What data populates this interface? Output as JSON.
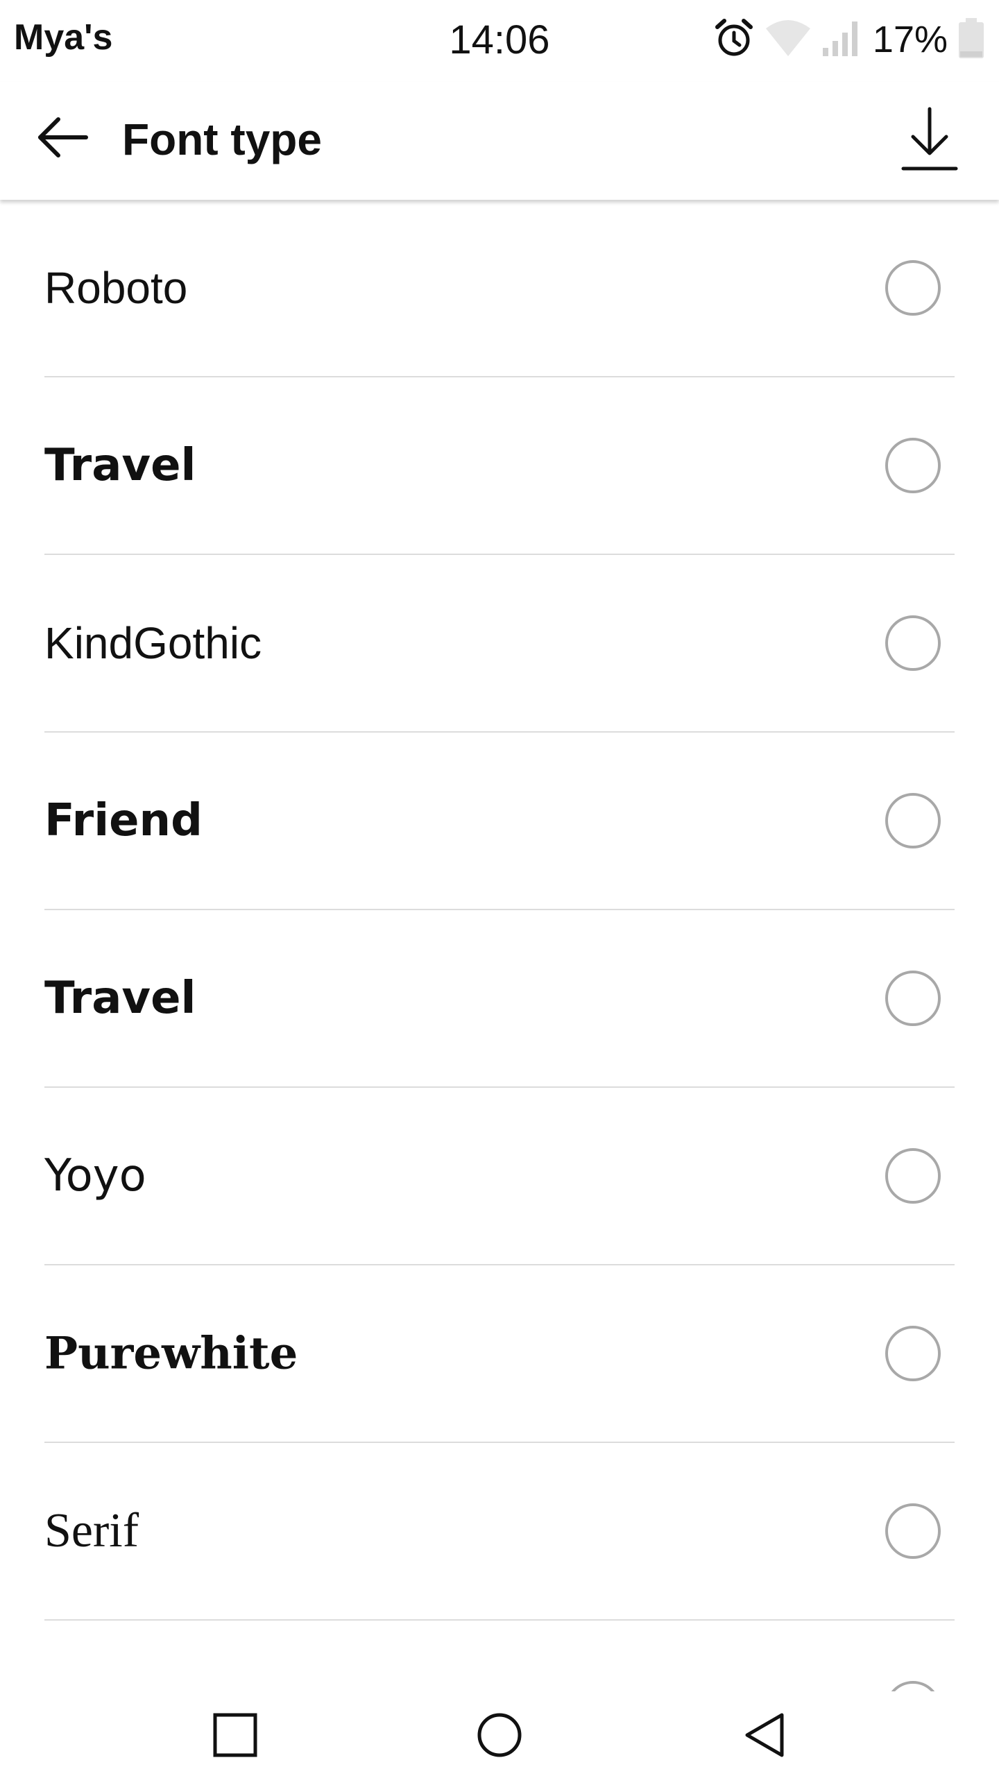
{
  "status_bar": {
    "carrier": "Mya's",
    "time": "14:06",
    "battery": "17%",
    "icons": [
      "alarm-icon",
      "wifi-icon",
      "signal-icon",
      "battery-icon"
    ]
  },
  "app_bar": {
    "title": "Font type",
    "back_icon": "arrow-left-icon",
    "download_icon": "download-icon"
  },
  "font_options": [
    {
      "label": "Roboto",
      "selected": false
    },
    {
      "label": "Travel",
      "selected": false
    },
    {
      "label": "KindGothic",
      "selected": false
    },
    {
      "label": "Friend",
      "selected": false
    },
    {
      "label": "Travel",
      "selected": false
    },
    {
      "label": "Yoyo",
      "selected": false
    },
    {
      "label": "Purewhite",
      "selected": false
    },
    {
      "label": "Serif",
      "selected": false
    }
  ],
  "nav_bar": {
    "icons": [
      "recents-icon",
      "home-icon",
      "back-icon"
    ]
  },
  "colors": {
    "text": "#111111",
    "divider": "#dcdcdc",
    "radio_border": "#a8a8a8",
    "background": "#ffffff"
  }
}
